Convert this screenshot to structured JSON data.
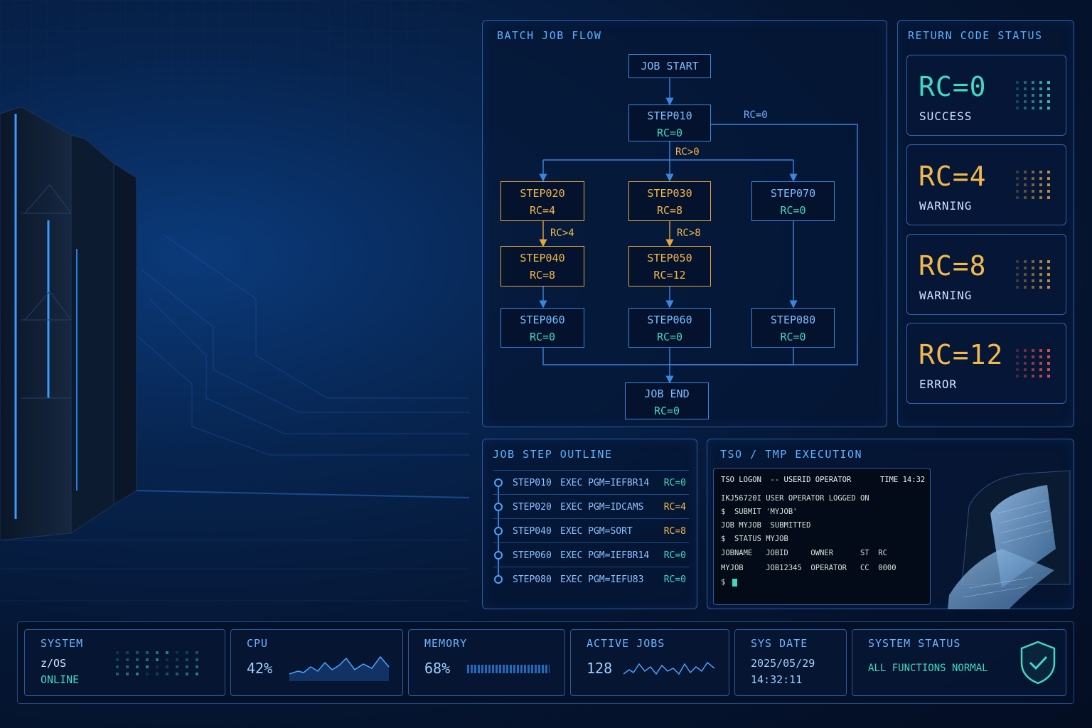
{
  "flow": {
    "title": "BATCH JOB FLOW",
    "job_start": "JOB START",
    "job_end": "JOB END",
    "job_end_rc": "RC=0",
    "steps": {
      "step010": {
        "name": "STEP010",
        "rc": "RC=0"
      },
      "step020": {
        "name": "STEP020",
        "rc": "RC=4"
      },
      "step030": {
        "name": "STEP030",
        "rc": "RC=8"
      },
      "step070": {
        "name": "STEP070",
        "rc": "RC=0"
      },
      "step040": {
        "name": "STEP040",
        "rc": "RC=8"
      },
      "step050": {
        "name": "STEP050",
        "rc": "RC=12"
      },
      "step060a": {
        "name": "STEP060",
        "rc": "RC=0"
      },
      "step060b": {
        "name": "STEP060",
        "rc": "RC=0"
      },
      "step080": {
        "name": "STEP080",
        "rc": "RC=0"
      }
    },
    "labels": {
      "rc0": "RC=0",
      "rc_gt0": "RC>0",
      "rc_gt4": "RC>4",
      "rc_gt8": "RC>8"
    }
  },
  "rc_status": {
    "title": "RETURN CODE STATUS",
    "cards": [
      {
        "value": "RC=0",
        "text": "SUCCESS",
        "color": "#3fd9c0"
      },
      {
        "value": "RC=4",
        "text": "WARNING",
        "color": "#f2b84a"
      },
      {
        "value": "RC=8",
        "text": "WARNING",
        "color": "#f2b84a"
      },
      {
        "value": "RC=12",
        "text": "ERROR",
        "color": "#f2b84a"
      }
    ]
  },
  "outline": {
    "title": "JOB STEP OUTLINE",
    "rows": [
      {
        "step": "STEP010",
        "exec": "EXEC PGM=IEFBR14",
        "rc": "RC=0"
      },
      {
        "step": "STEP020",
        "exec": "EXEC PGM=IDCAMS",
        "rc": "RC=4"
      },
      {
        "step": "STEP040",
        "exec": "EXEC PGM=SORT",
        "rc": "RC=8"
      },
      {
        "step": "STEP060",
        "exec": "EXEC PGM=IEFBR14",
        "rc": "RC=0"
      },
      {
        "step": "STEP080",
        "exec": "EXEC PGM=IEFU83",
        "rc": "RC=0"
      }
    ]
  },
  "tso": {
    "title": "TSO / TMP EXECUTION",
    "logon": "TSO LOGON  -- USERID OPERATOR",
    "time": "TIME 14:32",
    "lines": [
      "IKJ56720I USER OPERATOR LOGGED ON",
      "$  SUBMIT 'MYJOB'",
      "JOB MYJOB  SUBMITTED",
      "$  STATUS MYJOB",
      "JOBNAME   JOBID     OWNER      ST  RC",
      "MYJOB     JOB12345  OPERATOR   CC  0000",
      "$ "
    ]
  },
  "status_bar": {
    "system": {
      "label": "SYSTEM",
      "os": "z/OS",
      "state": "ONLINE"
    },
    "cpu": {
      "label": "CPU",
      "value": "42%"
    },
    "memory": {
      "label": "MEMORY",
      "value": "68%"
    },
    "active_jobs": {
      "label": "ACTIVE JOBS",
      "value": "128"
    },
    "sys_date": {
      "label": "SYS DATE",
      "date": "2025/05/29",
      "time": "14:32:11"
    },
    "system_status": {
      "label": "SYSTEM STATUS",
      "text": "ALL FUNCTIONS NORMAL"
    }
  },
  "colors": {
    "accent": "#4aa4ff",
    "success": "#3fd9c0",
    "warning": "#f2b84a",
    "error": "#ff5b4a"
  },
  "icons": [
    "mainframe-image",
    "printer-image",
    "shield-check-icon",
    "cursor-icon"
  ]
}
